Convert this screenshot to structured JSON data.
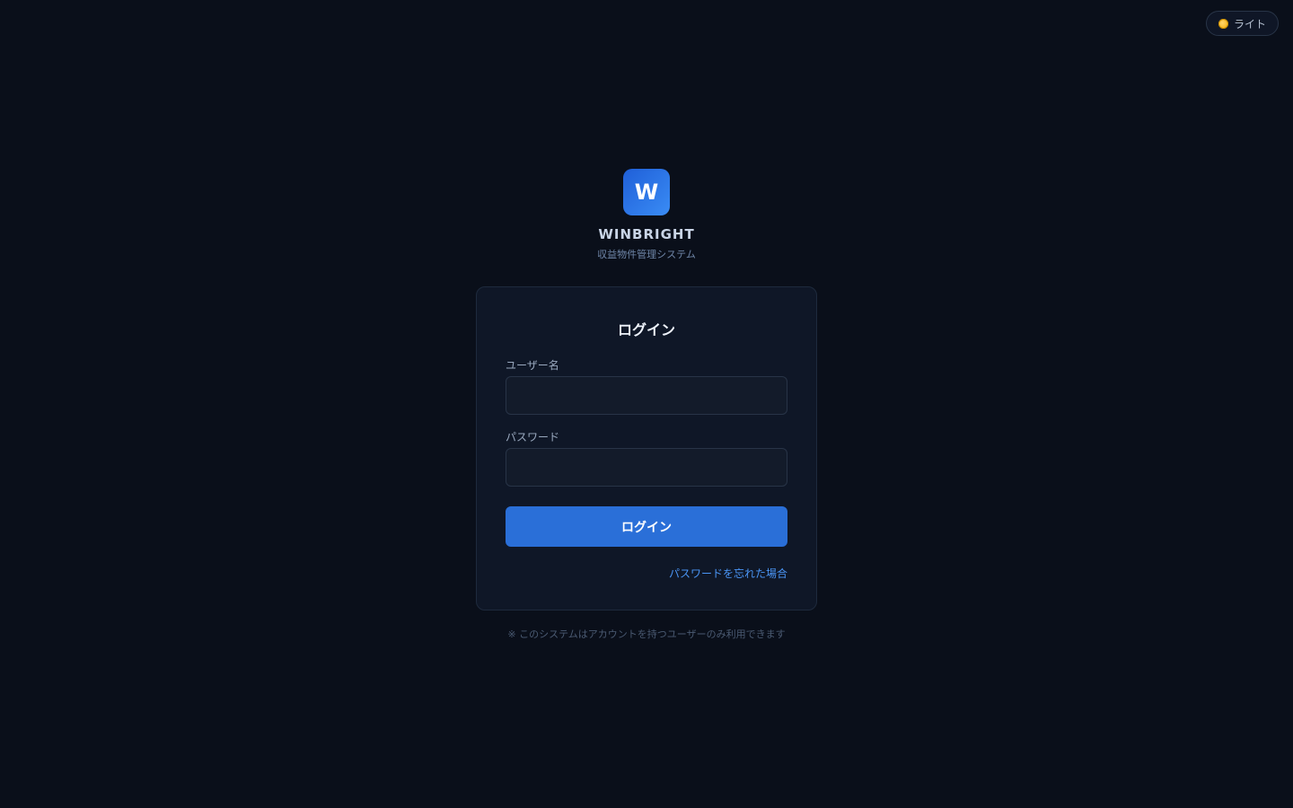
{
  "theme_toggle": {
    "label": "ライト",
    "icon": "sun-icon"
  },
  "brand": {
    "logo_letter": "W",
    "name": "WINBRIGHT",
    "subtitle": "収益物件管理システム"
  },
  "login_form": {
    "title": "ログイン",
    "username": {
      "label": "ユーザー名",
      "value": "",
      "placeholder": ""
    },
    "password": {
      "label": "パスワード",
      "value": "",
      "placeholder": ""
    },
    "submit_label": "ログイン",
    "forgot_password_link": "パスワードを忘れた場合"
  },
  "footnote": "※ このシステムはアカウントを持つユーザーのみ利用できます",
  "colors": {
    "background": "#0a0f1a",
    "card": "#0f1727",
    "accent": "#2a6fd8",
    "link": "#4a95f5"
  }
}
